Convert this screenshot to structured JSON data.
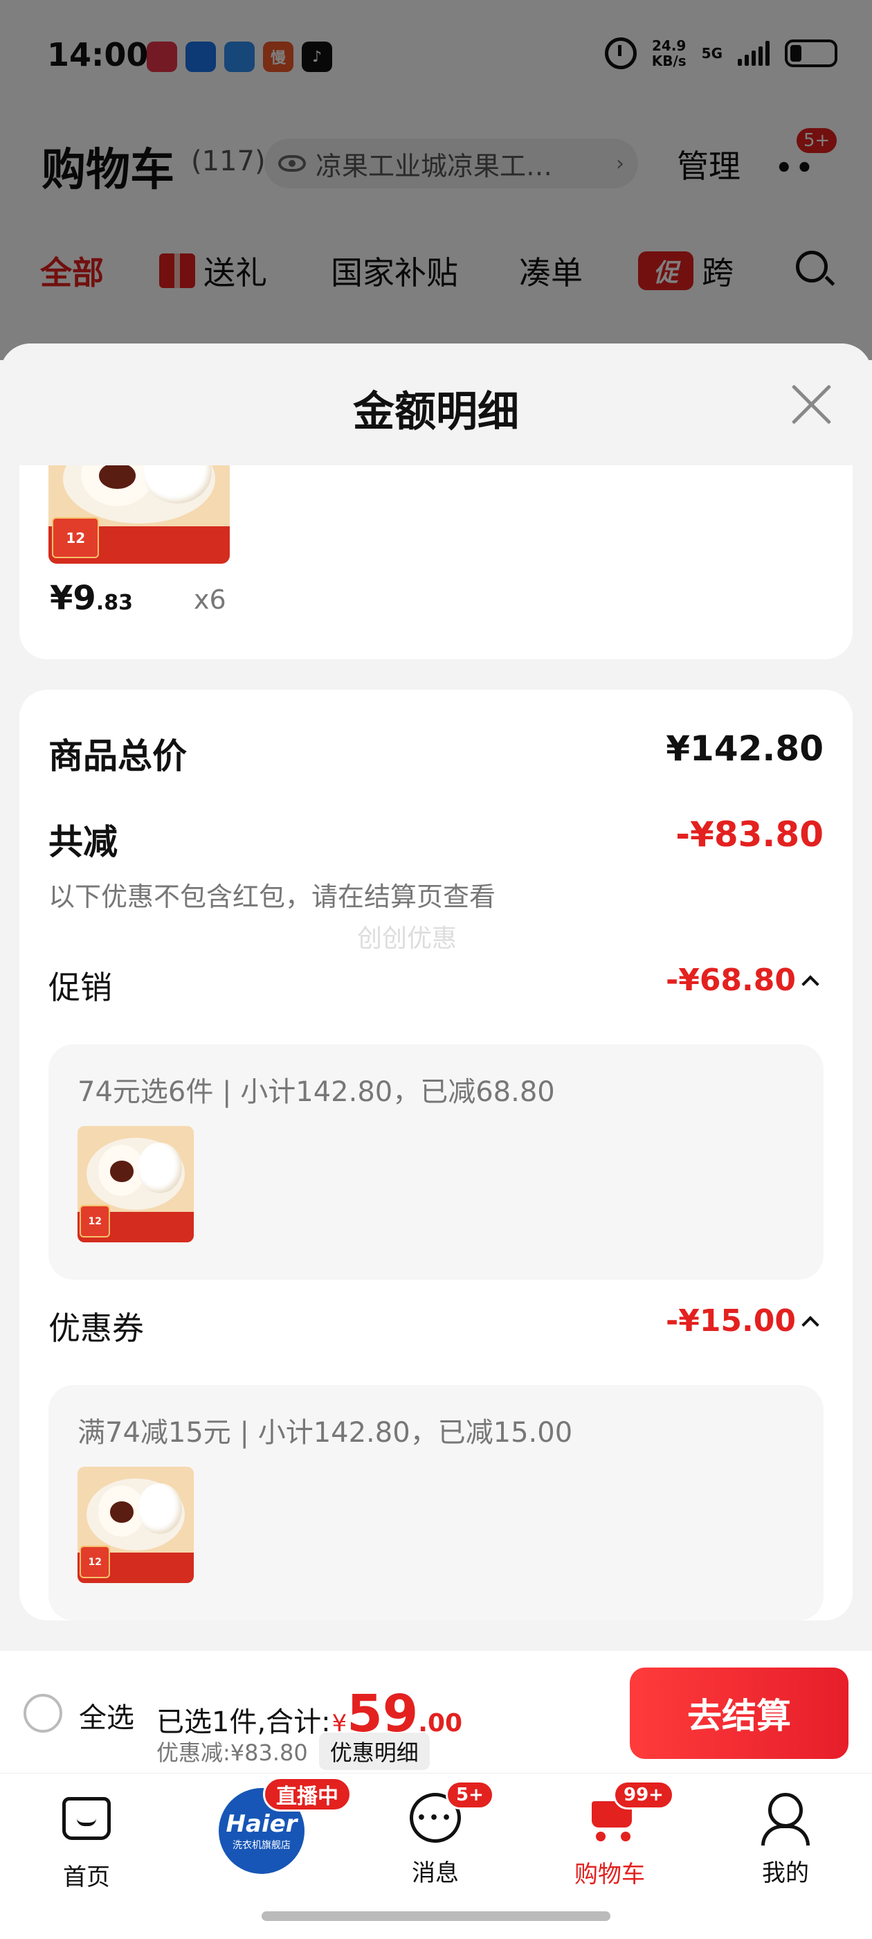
{
  "status_bar": {
    "time": "14:00",
    "apps": [
      {
        "icon": "xianyu-icon",
        "label": "",
        "color": "#e8344a"
      },
      {
        "icon": "ctrip-icon",
        "label": "",
        "color": "#1a73e8"
      },
      {
        "icon": "qq-browser-icon",
        "label": "",
        "color": "#2e8cf0"
      },
      {
        "icon": "man-icon",
        "label": "慢",
        "color": "#f05a28"
      },
      {
        "icon": "tiktok-icon",
        "label": "",
        "color": "#111111"
      }
    ],
    "net_speed": "24.9",
    "net_unit": "KB/s",
    "network": "5G"
  },
  "cart_header": {
    "title": "购物车",
    "count": "(117)",
    "address": "凉果工业城凉果工…",
    "manage": "管理",
    "more_badge": "5+"
  },
  "category_tabs": [
    {
      "label": "全部",
      "active": true
    },
    {
      "label": "送礼",
      "icon": "gift-icon"
    },
    {
      "label": "国家补贴"
    },
    {
      "label": "凑单"
    },
    {
      "label": "跨",
      "icon": "promo-icon",
      "icon_text": "促"
    }
  ],
  "sheet": {
    "title": "金额明细",
    "item": {
      "price_int": "¥9",
      "price_dec": ".83",
      "qty": "x6",
      "thumb_tag": "12"
    },
    "summary": {
      "total_label": "商品总价",
      "total_value": "¥142.80",
      "reduce_label": "共减",
      "reduce_value": "-¥83.80",
      "hint": "以下优惠不包含红包，请在结算页查看",
      "watermark": "创创优惠"
    },
    "promo": {
      "label": "促销",
      "value": "-¥68.80",
      "detail": "74元选6件 | 小计142.80，已减68.80"
    },
    "coupon": {
      "label": "优惠券",
      "value": "-¥15.00",
      "detail": "满74减15元 | 小计142.80，已减15.00"
    }
  },
  "checkout": {
    "select_all": "全选",
    "selected_text": "已选1件,合计:",
    "total_symbol": "¥",
    "total_int": "59",
    "total_dec": ".00",
    "discount_text": "优惠减:¥83.80",
    "detail_button": "优惠明细",
    "checkout_button": "去结算"
  },
  "bottom_nav": {
    "home": "首页",
    "live_brand": "Haier",
    "live_sub": "洗衣机旗舰店",
    "live_badge": "直播中",
    "messages": "消息",
    "messages_badge": "5+",
    "cart": "购物车",
    "cart_badge": "99+",
    "me": "我的"
  },
  "colors": {
    "accent": "#e3211f",
    "overlay": "rgba(0,0,0,0.5)"
  }
}
